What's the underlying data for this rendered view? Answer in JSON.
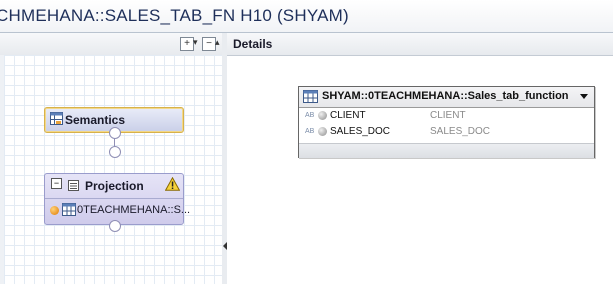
{
  "window": {
    "title": "CHMEHANA::SALES_TAB_FN H10 (SHYAM)"
  },
  "left_panel": {
    "toolbar": {
      "expand_icon": "expand-all-icon",
      "collapse_icon": "collapse-all-icon"
    },
    "nodes": {
      "semantics": {
        "label": "Semantics",
        "icon": "semantics-icon"
      },
      "projection": {
        "label": "Projection",
        "collapse_symbol": "−",
        "icon": "projection-icon",
        "warning_icon": "warning-icon",
        "source_label": "0TEACHMEHANA::S...",
        "source_icon": "table-function-icon"
      }
    }
  },
  "details": {
    "header": "Details",
    "table_node": {
      "title": "SHYAM::0TEACHMEHANA::Sales_tab_function",
      "columns": [
        {
          "type": "AB",
          "name": "CLIENT",
          "mapped": "CLIENT"
        },
        {
          "type": "AB",
          "name": "SALES_DOC",
          "mapped": "SALES_DOC"
        }
      ]
    }
  },
  "colors": {
    "title": "#1e2f5a",
    "semantics_border": "#d8b24a",
    "node_border": "#9a9ccc",
    "grid": "#e3ebf4"
  }
}
